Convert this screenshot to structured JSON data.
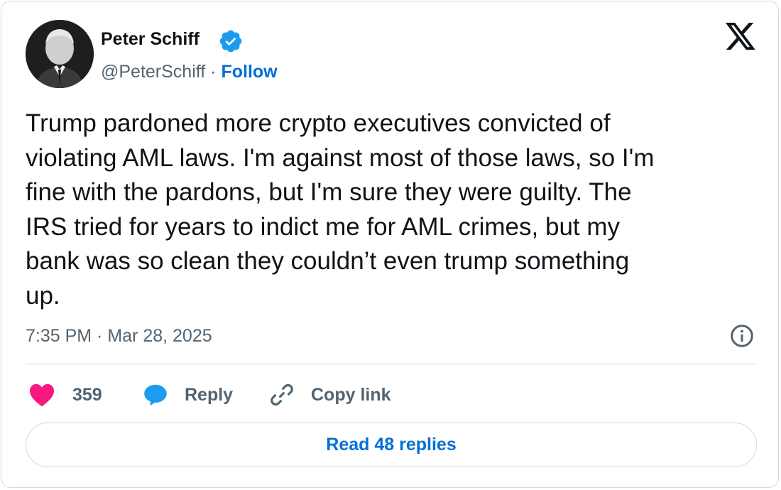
{
  "author": {
    "name": "Peter Schiff",
    "handle": "@PeterSchiff",
    "separator": "·",
    "follow_label": "Follow",
    "verified": true
  },
  "icons": {
    "verified": "verified-badge-icon",
    "platform": "x-logo-icon",
    "info": "info-icon",
    "like": "heart-icon",
    "reply": "speech-bubble-icon",
    "copy": "link-icon"
  },
  "tweet": {
    "text": "Trump pardoned more crypto executives convicted of\nviolating AML laws. I'm against most of those laws, so I'm\nfine with the pardons, but I'm sure they were guilty. The\nIRS tried for years to indict me for AML crimes, but my\nbank was so clean they couldn’t even trump something\nup.",
    "timestamp": "7:35 PM · Mar 28, 2025"
  },
  "actions": {
    "like_count": "359",
    "reply_label": "Reply",
    "copy_label": "Copy link"
  },
  "footer": {
    "read_replies_label": "Read 48 replies"
  },
  "colors": {
    "accent": "#006fd6",
    "verified": "#1d9bf0",
    "like": "#f91880",
    "muted": "#536471",
    "border": "#cfd9de"
  }
}
